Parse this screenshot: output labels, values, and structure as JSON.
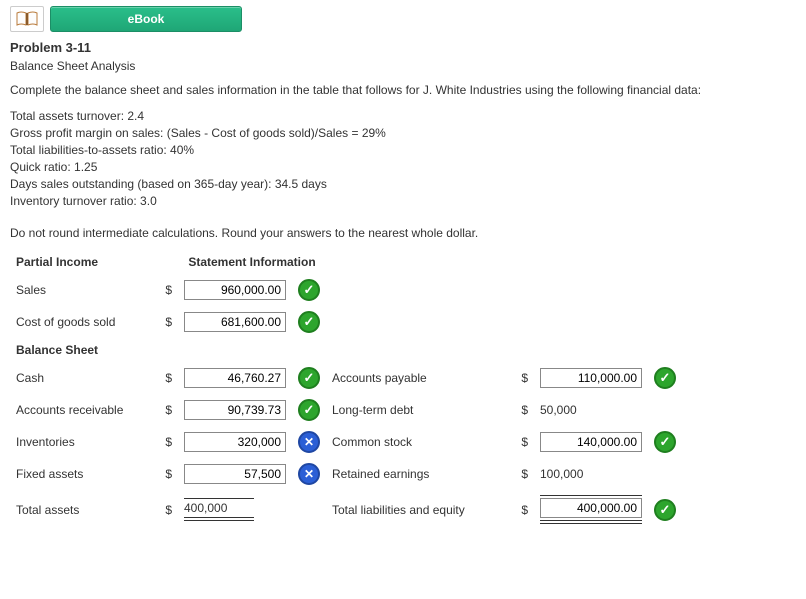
{
  "ebook_label": "eBook",
  "problem_title": "Problem 3-11",
  "subtitle": "Balance Sheet Analysis",
  "instructions": "Complete the balance sheet and sales information in the table that follows for J. White Industries using the following financial data:",
  "financial_data": [
    "Total assets turnover: 2.4",
    "Gross profit margin on sales: (Sales - Cost of goods sold)/Sales = 29%",
    "Total liabilities-to-assets ratio: 40%",
    "Quick ratio: 1.25",
    "Days sales outstanding (based on 365-day year): 34.5 days",
    "Inventory turnover ratio: 3.0"
  ],
  "note": "Do not round intermediate calculations. Round your answers to the nearest whole dollar.",
  "headers": {
    "partial_income": "Partial Income",
    "statement_info": "Statement Information",
    "balance_sheet": "Balance Sheet"
  },
  "dollar": "$",
  "labels": {
    "sales": "Sales",
    "cogs": "Cost of goods sold",
    "cash": "Cash",
    "ar": "Accounts receivable",
    "inventories": "Inventories",
    "fixed_assets": "Fixed assets",
    "total_assets": "Total assets",
    "ap": "Accounts payable",
    "ltd": "Long-term debt",
    "common_stock": "Common stock",
    "retained_earnings": "Retained earnings",
    "total_liab_equity": "Total liabilities and equity"
  },
  "values": {
    "sales": "960,000.00",
    "cogs": "681,600.00",
    "cash": "46,760.27",
    "ar": "90,739.73",
    "inventories": "320,000",
    "fixed_assets": "57,500",
    "total_assets": "400,000",
    "ap": "110,000.00",
    "ltd": "50,000",
    "common_stock": "140,000.00",
    "retained_earnings": "100,000",
    "total_liab_equity": "400,000.00"
  },
  "status": {
    "sales": "correct",
    "cogs": "correct",
    "cash": "correct",
    "ar": "correct",
    "inventories": "wrong",
    "fixed_assets": "wrong",
    "ap": "correct",
    "common_stock": "correct",
    "total_liab_equity": "correct"
  }
}
